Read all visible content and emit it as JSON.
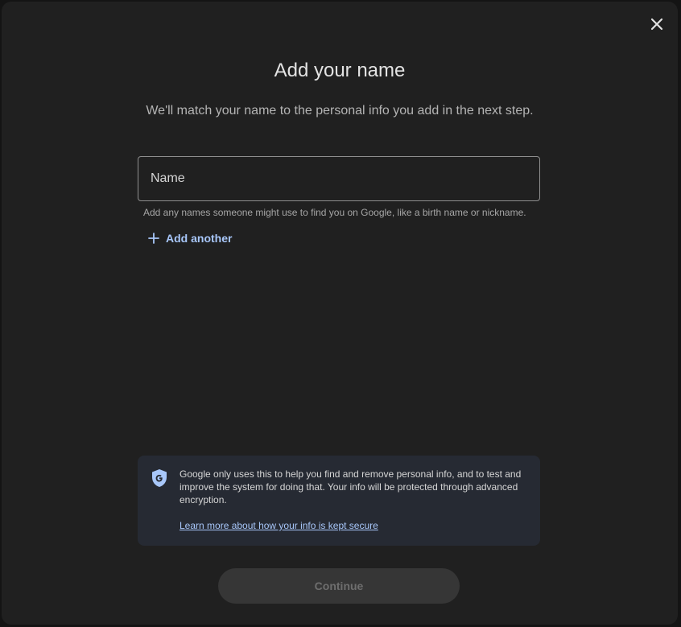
{
  "dialog": {
    "title": "Add your name",
    "subtitle": "We'll match your name to the personal info you add in the next step.",
    "close_icon": "close-icon"
  },
  "name_field": {
    "placeholder": "Name",
    "value": "",
    "helper": "Add any names someone might use to find you on Google, like a birth name or nickname."
  },
  "add_another": {
    "icon": "plus-icon",
    "label": "Add another"
  },
  "info_card": {
    "icon": "google-shield-icon",
    "text": "Google only uses this to help you find and remove personal info, and to test and improve the system for doing that. Your info will be protected through advanced encryption.",
    "link": "Learn more about how your info is kept secure"
  },
  "footer": {
    "continue_label": "Continue",
    "continue_disabled": true
  },
  "colors": {
    "background": "#202020",
    "accent": "#a8c7fa",
    "text": "#e3e3e3",
    "card": "#262a33",
    "disabled_button": "#363636"
  }
}
